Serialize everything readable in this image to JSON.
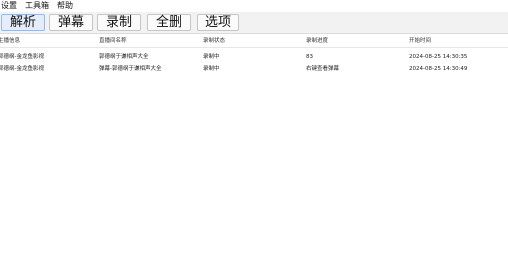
{
  "menubar": {
    "items": [
      {
        "label": "设置"
      },
      {
        "label": "工具箱"
      },
      {
        "label": "帮助"
      }
    ]
  },
  "toolbar": {
    "buttons": [
      {
        "label": "解析"
      },
      {
        "label": "弹幕"
      },
      {
        "label": "录制"
      },
      {
        "label": "全删"
      },
      {
        "label": "选项"
      }
    ]
  },
  "table": {
    "columns": [
      "主播信息",
      "直播间名称",
      "录制状态",
      "录制进度",
      "开始时间"
    ],
    "rows": [
      [
        "郭德纲-金龙鱼影视",
        "郭德纲于谦相声大全",
        "录制中",
        "83",
        "2024-08-25 14:30:35"
      ],
      [
        "郭德纲-金龙鱼影视",
        "弹幕-郭德纲于谦相声大全",
        "录制中",
        "右键查看弹幕",
        "2024-08-25 14:30:49"
      ]
    ]
  }
}
